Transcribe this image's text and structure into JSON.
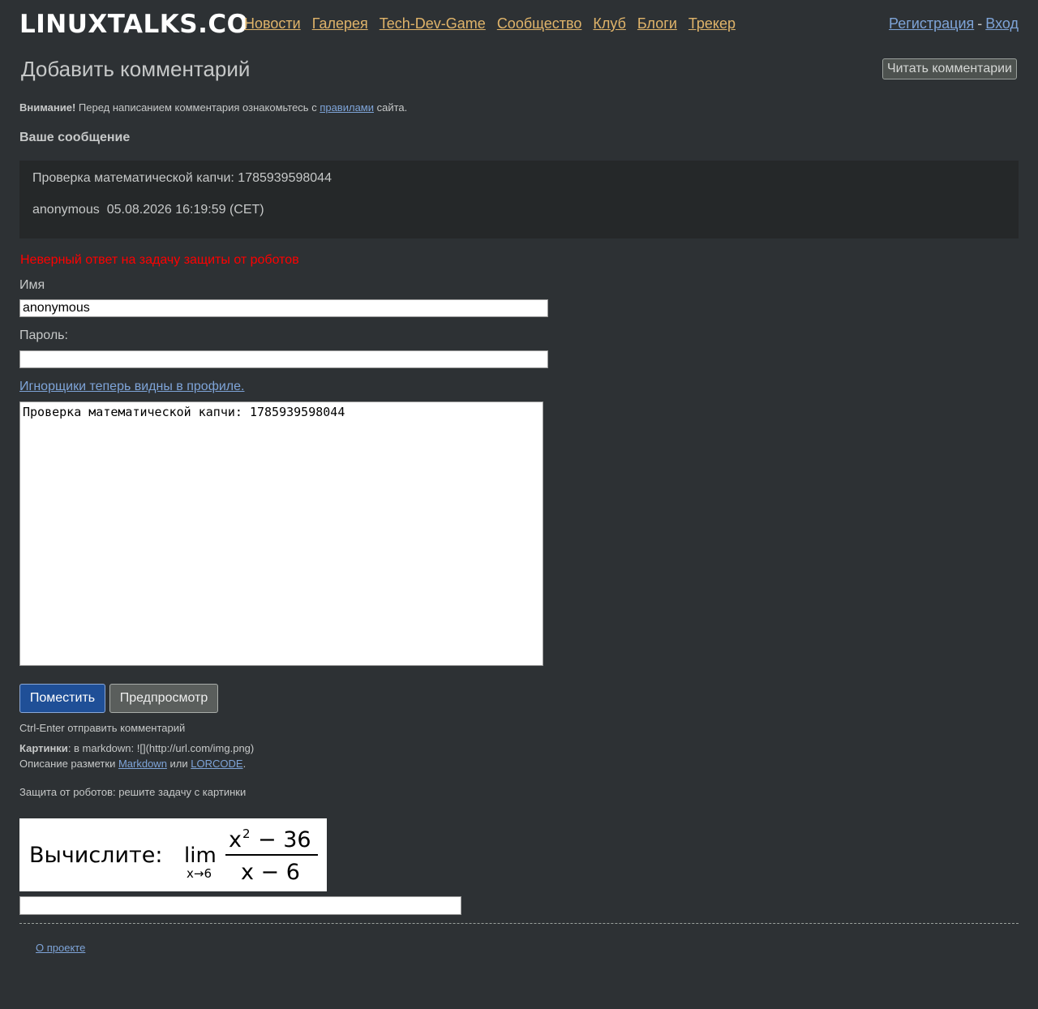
{
  "site": {
    "logo": "LINUXTALKS.CO",
    "nav": [
      "Новости",
      "Галерея",
      "Tech-Dev-Game",
      "Сообщество",
      "Клуб",
      "Блоги",
      "Трекер"
    ],
    "auth": {
      "register": "Регистрация",
      "separator": "-",
      "login": "Вход"
    }
  },
  "page": {
    "title": "Добавить комментарий",
    "read_comments_button": "Читать комментарии",
    "notice": {
      "bold": "Внимание!",
      "before": " Перед написанием комментария ознакомьтесь с ",
      "link": "правилами",
      "after": " сайта."
    },
    "your_message_heading": "Ваше сообщение",
    "preview": {
      "text": "Проверка математической капчи: 1785939598044",
      "author": "anonymous",
      "date": "05.08.2026 16:19:59 (CET)"
    },
    "error": "Неверный ответ на задачу защиты от роботов",
    "form": {
      "name_label": "Имя",
      "name_value": "anonymous",
      "password_label": "Пароль:",
      "password_value": "",
      "ignore_link": "Игнорщики теперь видны в профиле.",
      "message_value": "Проверка математической капчи: 1785939598044",
      "submit_label": "Поместить",
      "preview_label": "Предпросмотр"
    },
    "hints": {
      "ctrl_enter": "Ctrl-Enter отправить комментарий",
      "images_bold": "Картинки",
      "images_text": ": в markdown: ![](http://url.com/img.png)",
      "markup_before": "Описание разметки ",
      "markup_link1": "Markdown",
      "markup_or": " или ",
      "markup_link2": "LORCODE",
      "markup_after": ".",
      "captcha_prompt": "Защита от роботов: решите задачу с картинки"
    },
    "captcha": {
      "word": "Вычислите:",
      "lim": "lim",
      "sub": "x→6",
      "numerator_base": "x",
      "numerator_exp": "2",
      "numerator_rest": "− 36",
      "denominator": "x − 6"
    },
    "footer": {
      "about": "О проекте"
    }
  }
}
